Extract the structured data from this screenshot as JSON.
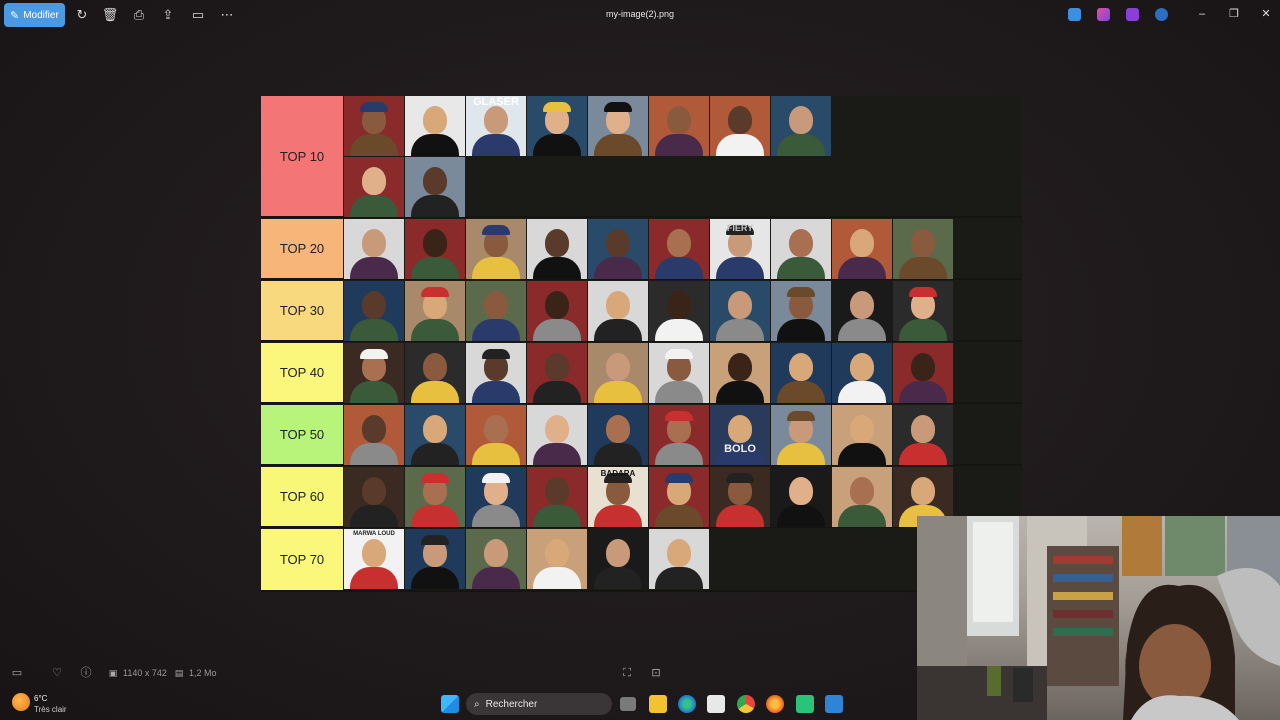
{
  "toolbar": {
    "edit_label": "Modifier",
    "file_title": "my-image(2).png"
  },
  "tiers": [
    {
      "label": "TOP 10",
      "color": "#f47576"
    },
    {
      "label": "TOP 20",
      "color": "#f7b57a"
    },
    {
      "label": "TOP 30",
      "color": "#f9d97d"
    },
    {
      "label": "TOP 40",
      "color": "#fbf67c"
    },
    {
      "label": "TOP 50",
      "color": "#b8f37a"
    },
    {
      "label": "TOP 60",
      "color": "#f9f777"
    },
    {
      "label": "TOP 70",
      "color": "#fbf77b"
    }
  ],
  "thumb_text": {
    "bolo": "BOLO",
    "badara": "BADARA",
    "marwa": "MARWA LOUD",
    "glaser": "GLASER",
    "fiery": "FIERY"
  },
  "infobar": {
    "dimensions": "1140 x 742",
    "filesize": "1,2 Mo"
  },
  "taskbar": {
    "temperature": "6°C",
    "weather": "Très clair",
    "search_label": "Rechercher"
  }
}
